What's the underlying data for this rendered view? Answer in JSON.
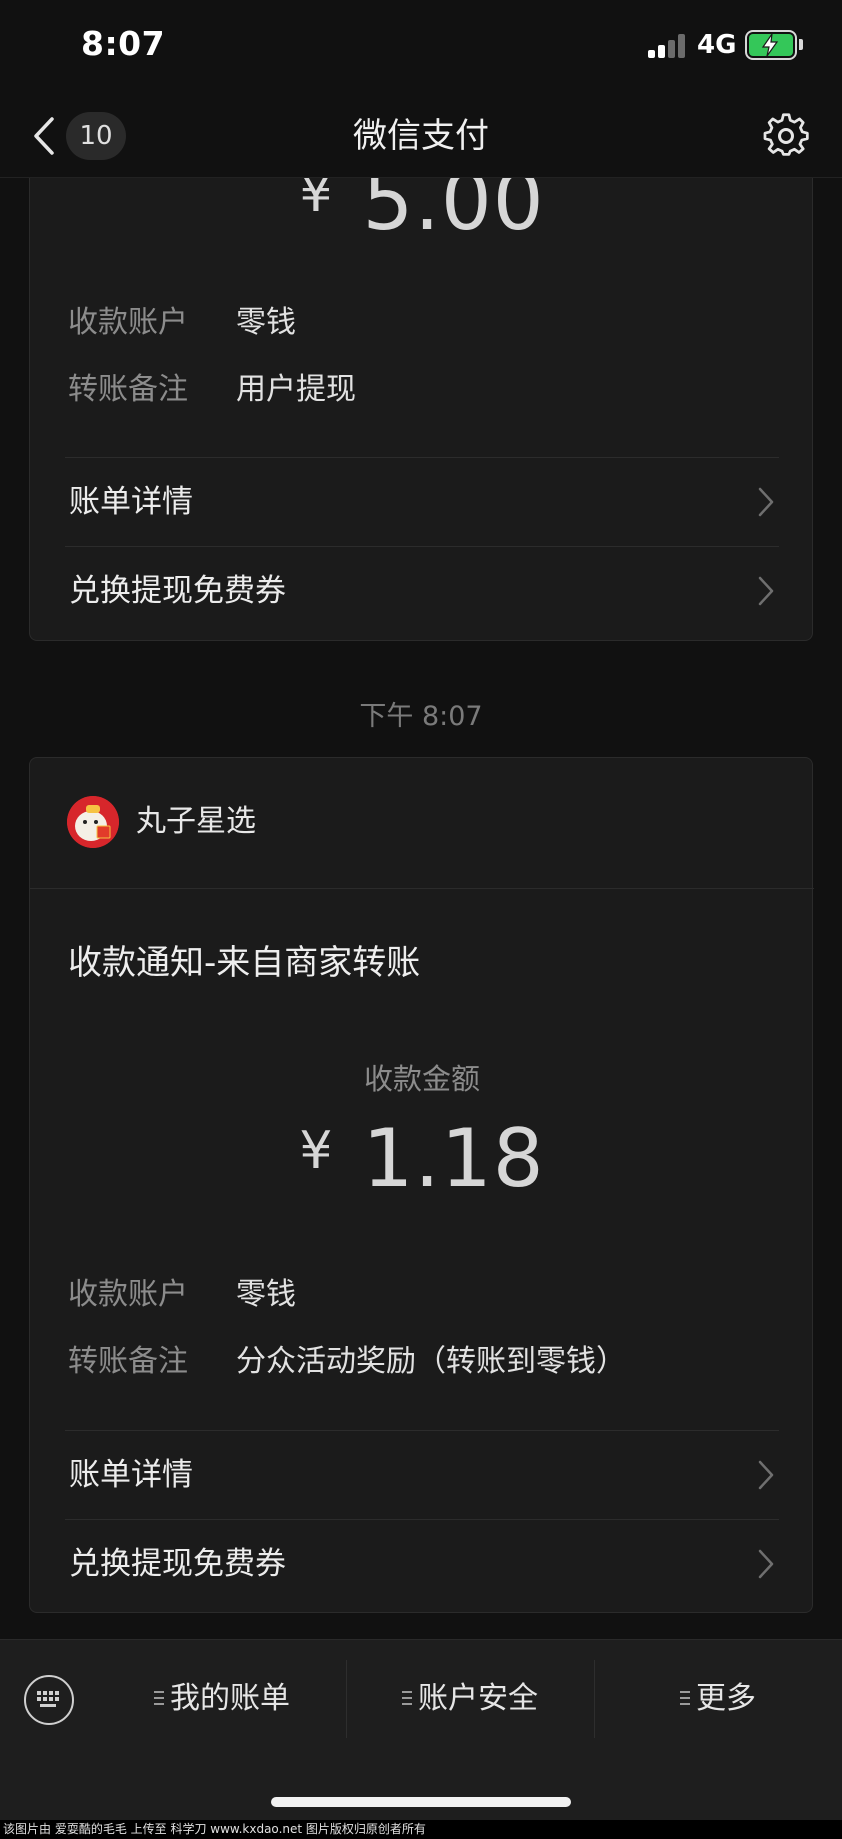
{
  "status_bar": {
    "time": "8:07",
    "network": "4G",
    "battery_color": "#34c759",
    "icons": [
      "signal-icon",
      "battery-charging-icon"
    ]
  },
  "nav": {
    "back_icon": "chevron-left-icon",
    "unread_count": "10",
    "title": "微信支付",
    "settings_icon": "gear-icon"
  },
  "messages": [
    {
      "amount_currency": "¥",
      "amount_value": "5.00",
      "rows": [
        {
          "key": "收款账户",
          "value": "零钱"
        },
        {
          "key": "转账备注",
          "value": "用户提现"
        }
      ],
      "links": [
        {
          "label": "账单详情"
        },
        {
          "label": "兑换提现免费券"
        }
      ]
    },
    {
      "timestamp": "下午 8:07",
      "merchant_name": "丸子星选",
      "merchant_avatar_color": "#d7262b",
      "title": "收款通知-来自商家转账",
      "amount_caption": "收款金额",
      "amount_currency": "¥",
      "amount_value": "1.18",
      "rows": [
        {
          "key": "收款账户",
          "value": "零钱"
        },
        {
          "key": "转账备注",
          "value": "分众活动奖励（转账到零钱）"
        }
      ],
      "links": [
        {
          "label": "账单详情"
        },
        {
          "label": "兑换提现免费券"
        }
      ]
    }
  ],
  "bottom_menu": {
    "keyboard_icon": "keyboard-icon",
    "items": [
      {
        "label": "我的账单"
      },
      {
        "label": "账户安全"
      },
      {
        "label": "更多"
      }
    ]
  },
  "watermark": "该图片由 爱耍酷的毛毛 上传至 科学刀 www.kxdao.net 图片版权归原创者所有"
}
